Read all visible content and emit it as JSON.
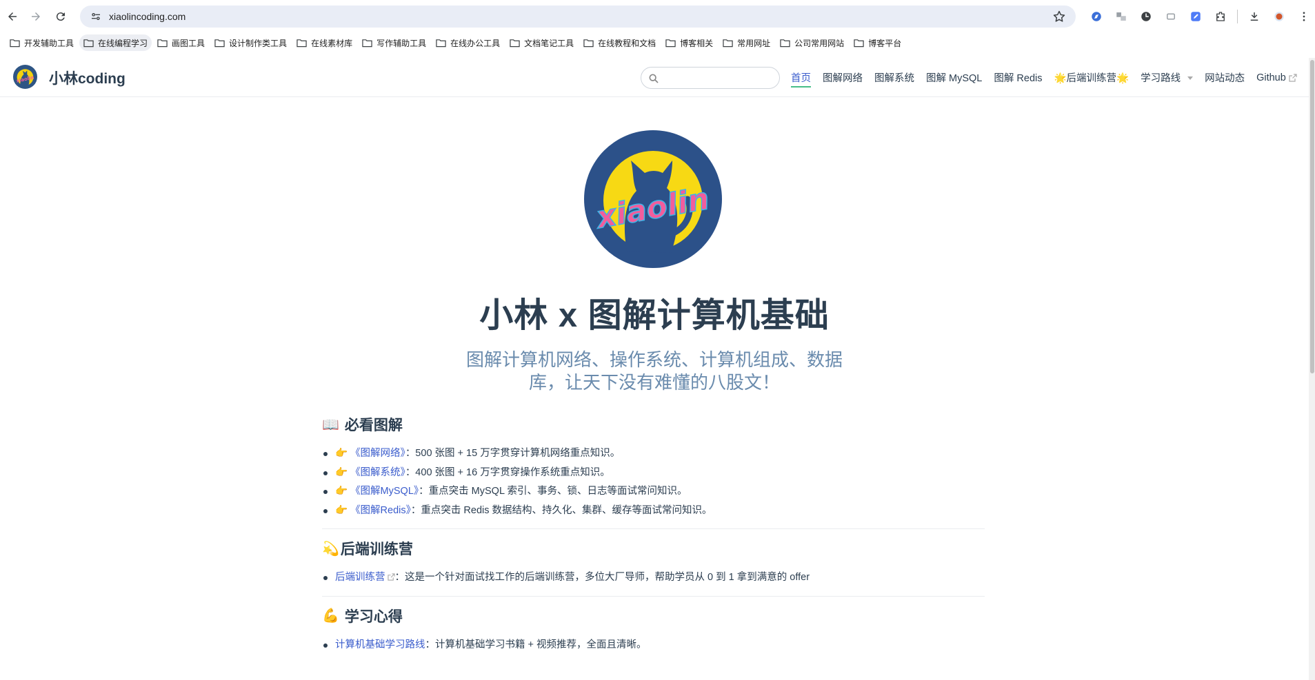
{
  "browser": {
    "url": "xiaolincoding.com",
    "bookmarks": [
      "开发辅助工具",
      "在线编程学习",
      "画图工具",
      "设计制作类工具",
      "在线素材库",
      "写作辅助工具",
      "在线办公工具",
      "文档笔记工具",
      "在线教程和文档",
      "博客相关",
      "常用网址",
      "公司常用网站",
      "博客平台"
    ],
    "icons": {
      "back": "arrow-left-icon",
      "forward": "arrow-right-icon",
      "reload": "reload-icon",
      "site_info": "tune-icon",
      "bookmark_star": "star-icon",
      "downloads": "download-icon",
      "menu": "kebab-menu-icon"
    }
  },
  "site": {
    "name": "小林coding",
    "search_placeholder": "",
    "nav": {
      "home": "首页",
      "network": "图解网络",
      "system": "图解系统",
      "mysql": "图解 MySQL",
      "redis": "图解 Redis",
      "camp": "🌟后端训练营🌟",
      "roadmap": "学习路线",
      "news": "网站动态",
      "github": "Github"
    },
    "colors": {
      "accent": "#3a5ccc",
      "active_underline": "#46bd87",
      "text": "#2c3e50",
      "subtitle": "#6a8bad"
    }
  },
  "hero": {
    "logo_text": "xiaolin",
    "title": "小林 x 图解计算机基础",
    "description": "图解计算机网络、操作系统、计算机组成、数据库，让天下没有难懂的八股文！"
  },
  "sections": {
    "must_read": {
      "emoji": "📖",
      "title": "必看图解",
      "items": [
        {
          "pointer": "👉",
          "link": "《图解网络》",
          "text": "：500 张图 + 15 万字贯穿计算机网络重点知识。"
        },
        {
          "pointer": "👉",
          "link": "《图解系统》",
          "text": "：400 张图 + 16 万字贯穿操作系统重点知识。"
        },
        {
          "pointer": "👉",
          "link": "《图解MySQL》",
          "text": "：重点突击 MySQL 索引、事务、锁、日志等面试常问知识。"
        },
        {
          "pointer": "👉",
          "link": "《图解Redis》",
          "text": "：重点突击 Redis 数据结构、持久化、集群、缓存等面试常问知识。"
        }
      ]
    },
    "backend_camp": {
      "emoji": "💫",
      "title": "后端训练营",
      "items": [
        {
          "link": "后端训练营",
          "text": "：这是一个针对面试找工作的后端训练营，多位大厂导师，帮助学员从 0 到 1 拿到满意的 offer"
        }
      ]
    },
    "learning": {
      "emoji": "💪",
      "title": "学习心得",
      "items": [
        {
          "link": "计算机基础学习路线",
          "text": "：计算机基础学习书籍 + 视频推荐，全面且清晰。"
        }
      ]
    }
  }
}
